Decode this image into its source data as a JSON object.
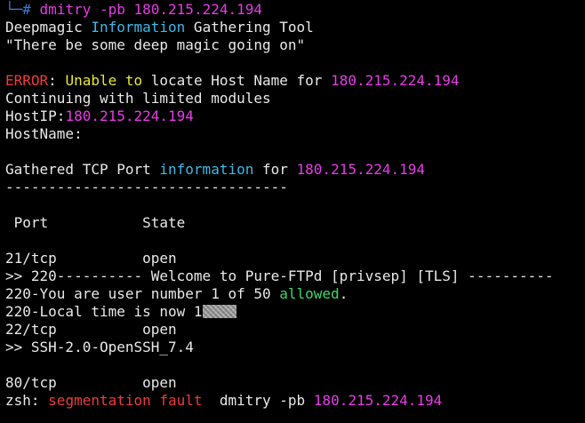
{
  "terminal": {
    "prompt": {
      "corner": "└─",
      "symbol": "#",
      "command": "dmitry -pb 180.215.224.194"
    },
    "banner": {
      "title_1": "Deepmagic ",
      "title_2": "Information",
      "title_3": " Gathering Tool",
      "quote": "\"There be some deep magic going on\""
    },
    "error": {
      "label": "ERROR",
      "sep": ": ",
      "msg_1": "Unable to",
      "msg_2": " locate Host Name for ",
      "ip": "180.215.224.194"
    },
    "continuing": "Continuing with limited modules",
    "hostip": {
      "label": "HostIP:",
      "value": "180.215.224.194"
    },
    "hostname": {
      "label": "HostName:"
    },
    "tcp": {
      "head_1": "Gathered TCP Port ",
      "head_2": "information",
      "head_3": " for ",
      "ip": "180.215.224.194",
      "divider": "---------------------------------",
      "col_port": " Port",
      "col_state": "State"
    },
    "ports": {
      "p21": {
        "port": "21/tcp",
        "state": "open",
        "banner": ">> 220---------- Welcome to Pure-FTPd [privsep] [TLS] ----------",
        "users_1": "220-You are user number 1 of 50 ",
        "users_2": "allowed",
        "users_3": ".",
        "time": "220-Local time is now 1"
      },
      "p22": {
        "port": "22/tcp",
        "state": "open",
        "banner": ">> SSH-2.0-OpenSSH_7.4"
      },
      "p80": {
        "port": "80/tcp",
        "state": "open"
      }
    },
    "crash": {
      "shell": "zsh: ",
      "msg": "segmentation fault",
      "cmd": "  dmitry -pb ",
      "ip": "180.215.224.194"
    }
  }
}
